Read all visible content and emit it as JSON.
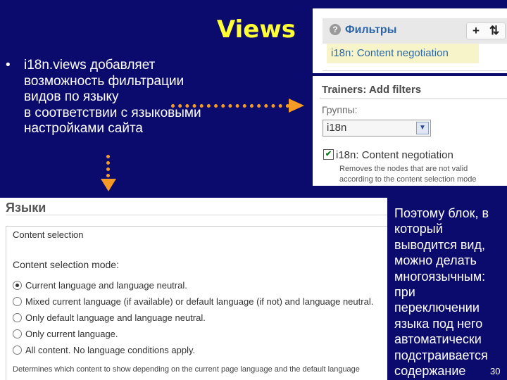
{
  "slide": {
    "title": "Views",
    "bullet_mark": "•",
    "bullet_lines": [
      "i18n.views добавляет",
      "возможность фильтрации",
      "видов по языку",
      "в соответствии с языковыми",
      "настройками сайта"
    ],
    "note_lines": [
      "Поэтому блок, в",
      "который",
      "выводится вид,",
      "можно делать",
      "многоязычным:",
      "при",
      "переключении",
      "языка под него",
      "автоматически",
      "подстраивается",
      "содержание"
    ],
    "page_number": "30",
    "accent_color": "#f59a24",
    "title_color": "#ffff33",
    "background_color": "#0b0b6e"
  },
  "filters_panel": {
    "help_icon": "?",
    "title": "Фильтры",
    "add_button": "+",
    "sort_button": "⇅",
    "item": "i18n: Content negotiation"
  },
  "trainers_panel": {
    "title": "Trainers: Add filters",
    "groups_label": "Группы:",
    "groups_value": "i18n",
    "dropdown_icon": "▼",
    "checkbox_mark": "✔",
    "checkbox_label": "i18n: Content negotiation",
    "description_lines": [
      "Removes the nodes that are not valid",
      "according to the content selection mode"
    ]
  },
  "languages_panel": {
    "title": "Языки",
    "legend": "Content selection",
    "mode_label": "Content selection mode:",
    "options": [
      {
        "label": "Current language and language neutral.",
        "selected": true
      },
      {
        "label": "Mixed current language (if available) or default language (if not) and language neutral.",
        "selected": false
      },
      {
        "label": "Only default language and language neutral.",
        "selected": false
      },
      {
        "label": "Only current language.",
        "selected": false
      },
      {
        "label": "All content. No language conditions apply.",
        "selected": false
      }
    ],
    "help_text": "Determines which content to show depending on the current page language and the default language"
  }
}
